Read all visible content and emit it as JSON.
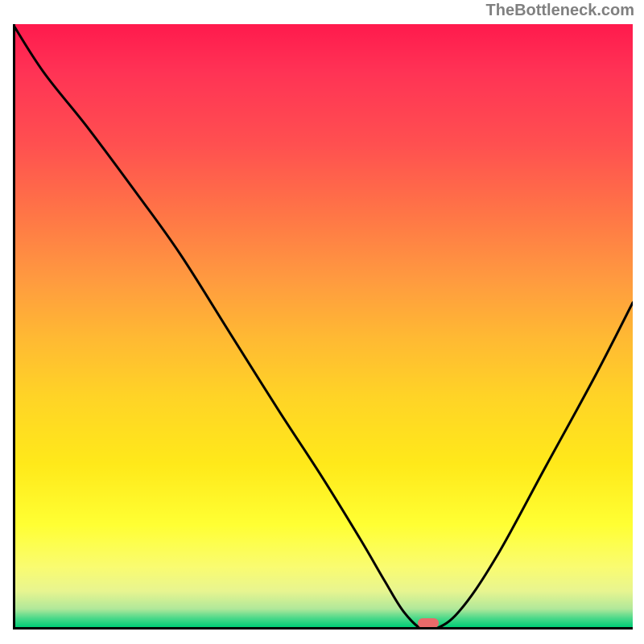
{
  "watermark": "TheBottleneck.com",
  "chart_data": {
    "type": "line",
    "title": "",
    "xlabel": "",
    "ylabel": "",
    "xlim": [
      0,
      100
    ],
    "ylim": [
      0,
      100
    ],
    "background": "gradient-bottleneck",
    "series": [
      {
        "name": "bottleneck-curve",
        "color": "#000000",
        "x": [
          0,
          5,
          12,
          20,
          27,
          35,
          43,
          50,
          56,
          60,
          63,
          66,
          68,
          72,
          78,
          86,
          94,
          100
        ],
        "y": [
          100,
          92,
          83,
          72,
          62,
          49,
          36,
          25,
          15,
          8,
          3,
          0,
          0,
          3,
          12,
          27,
          42,
          54
        ]
      }
    ],
    "marker": {
      "x": 67,
      "y": 0,
      "label": "optimal-point",
      "color": "#e86a6a"
    }
  }
}
